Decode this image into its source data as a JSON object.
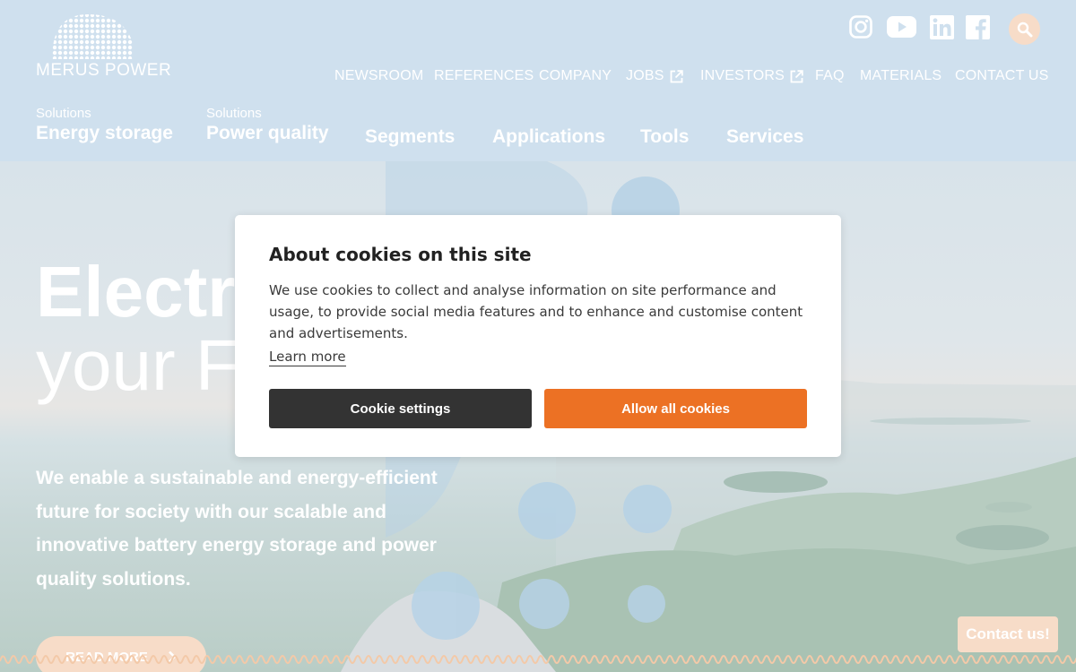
{
  "brand": {
    "logo_text": "MERUS POWER"
  },
  "social": [
    "instagram-icon",
    "youtube-icon",
    "linkedin-icon",
    "facebook-icon"
  ],
  "top_nav": [
    {
      "label": "NEWSROOM",
      "external": false
    },
    {
      "label": "REFERENCES",
      "external": false
    },
    {
      "label": "COMPANY",
      "external": false
    },
    {
      "label": "JOBS",
      "external": true
    },
    {
      "label": "INVESTORS",
      "external": true
    },
    {
      "label": "FAQ",
      "external": false
    },
    {
      "label": "MATERIALS",
      "external": false
    },
    {
      "label": "CONTACT US",
      "external": false
    }
  ],
  "main_nav": [
    {
      "small": "Solutions",
      "label": "Energy storage"
    },
    {
      "small": "Solutions",
      "label": "Power quality"
    },
    {
      "small": "",
      "label": "Segments"
    },
    {
      "small": "",
      "label": "Applications"
    },
    {
      "small": "",
      "label": "Tools"
    },
    {
      "small": "",
      "label": "Services"
    }
  ],
  "hero": {
    "title_bold": "Electri",
    "title_light": "your F",
    "text": "We enable a sustainable and energy-efficient future for society with our scalable and innovative battery energy storage and power quality solutions.",
    "read_more": "READ MORE",
    "read_more_icon": "chevron-right-icon"
  },
  "contact_us": "Contact us!",
  "cookie": {
    "title": "About cookies on this site",
    "body": "We use cookies to collect and analyse information on site performance and usage, to provide social media features and to enhance and customise content and advertisements.",
    "learn_more": "Learn more",
    "settings_button": "Cookie settings",
    "allow_button": "Allow all cookies"
  },
  "colors": {
    "header_bg": "#cfe0ee",
    "accent_orange": "#ec7124",
    "button_dark": "#333333",
    "overlay_peach": "#f7dcc8"
  }
}
